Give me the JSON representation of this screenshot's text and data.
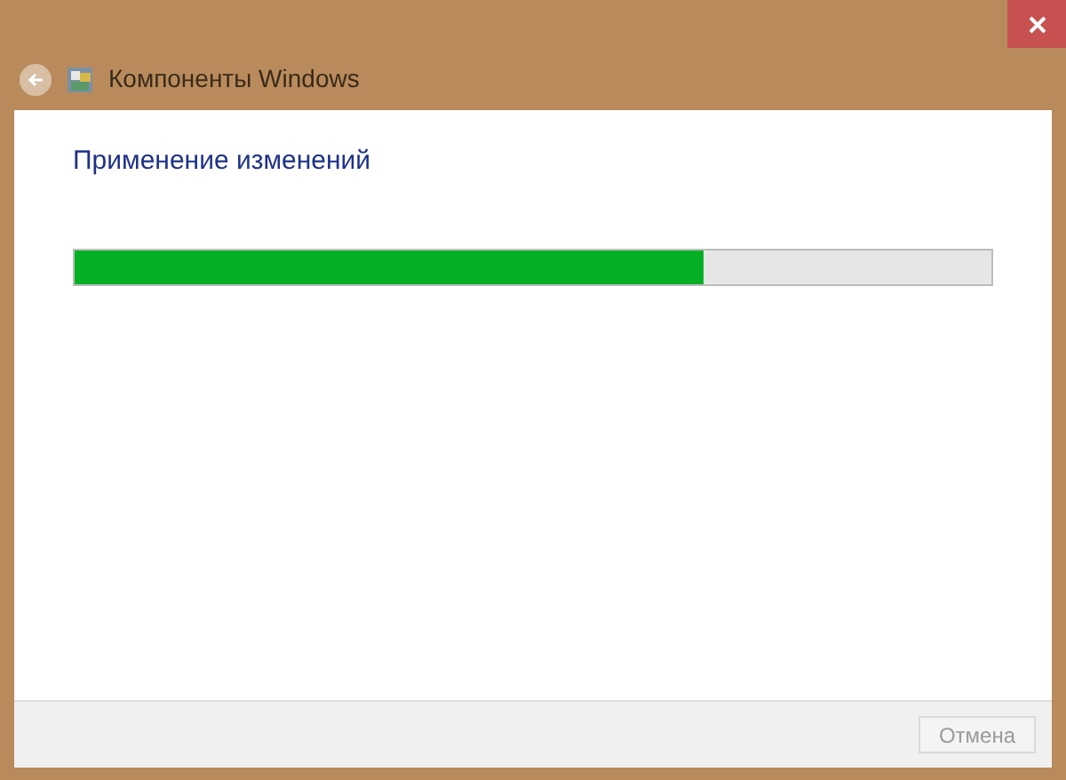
{
  "window": {
    "title": "Компоненты Windows"
  },
  "heading": "Применение изменений",
  "progress": {
    "level": 0.687
  },
  "buttons": [
    {
      "label": "Отмена",
      "disabled": true
    }
  ]
}
